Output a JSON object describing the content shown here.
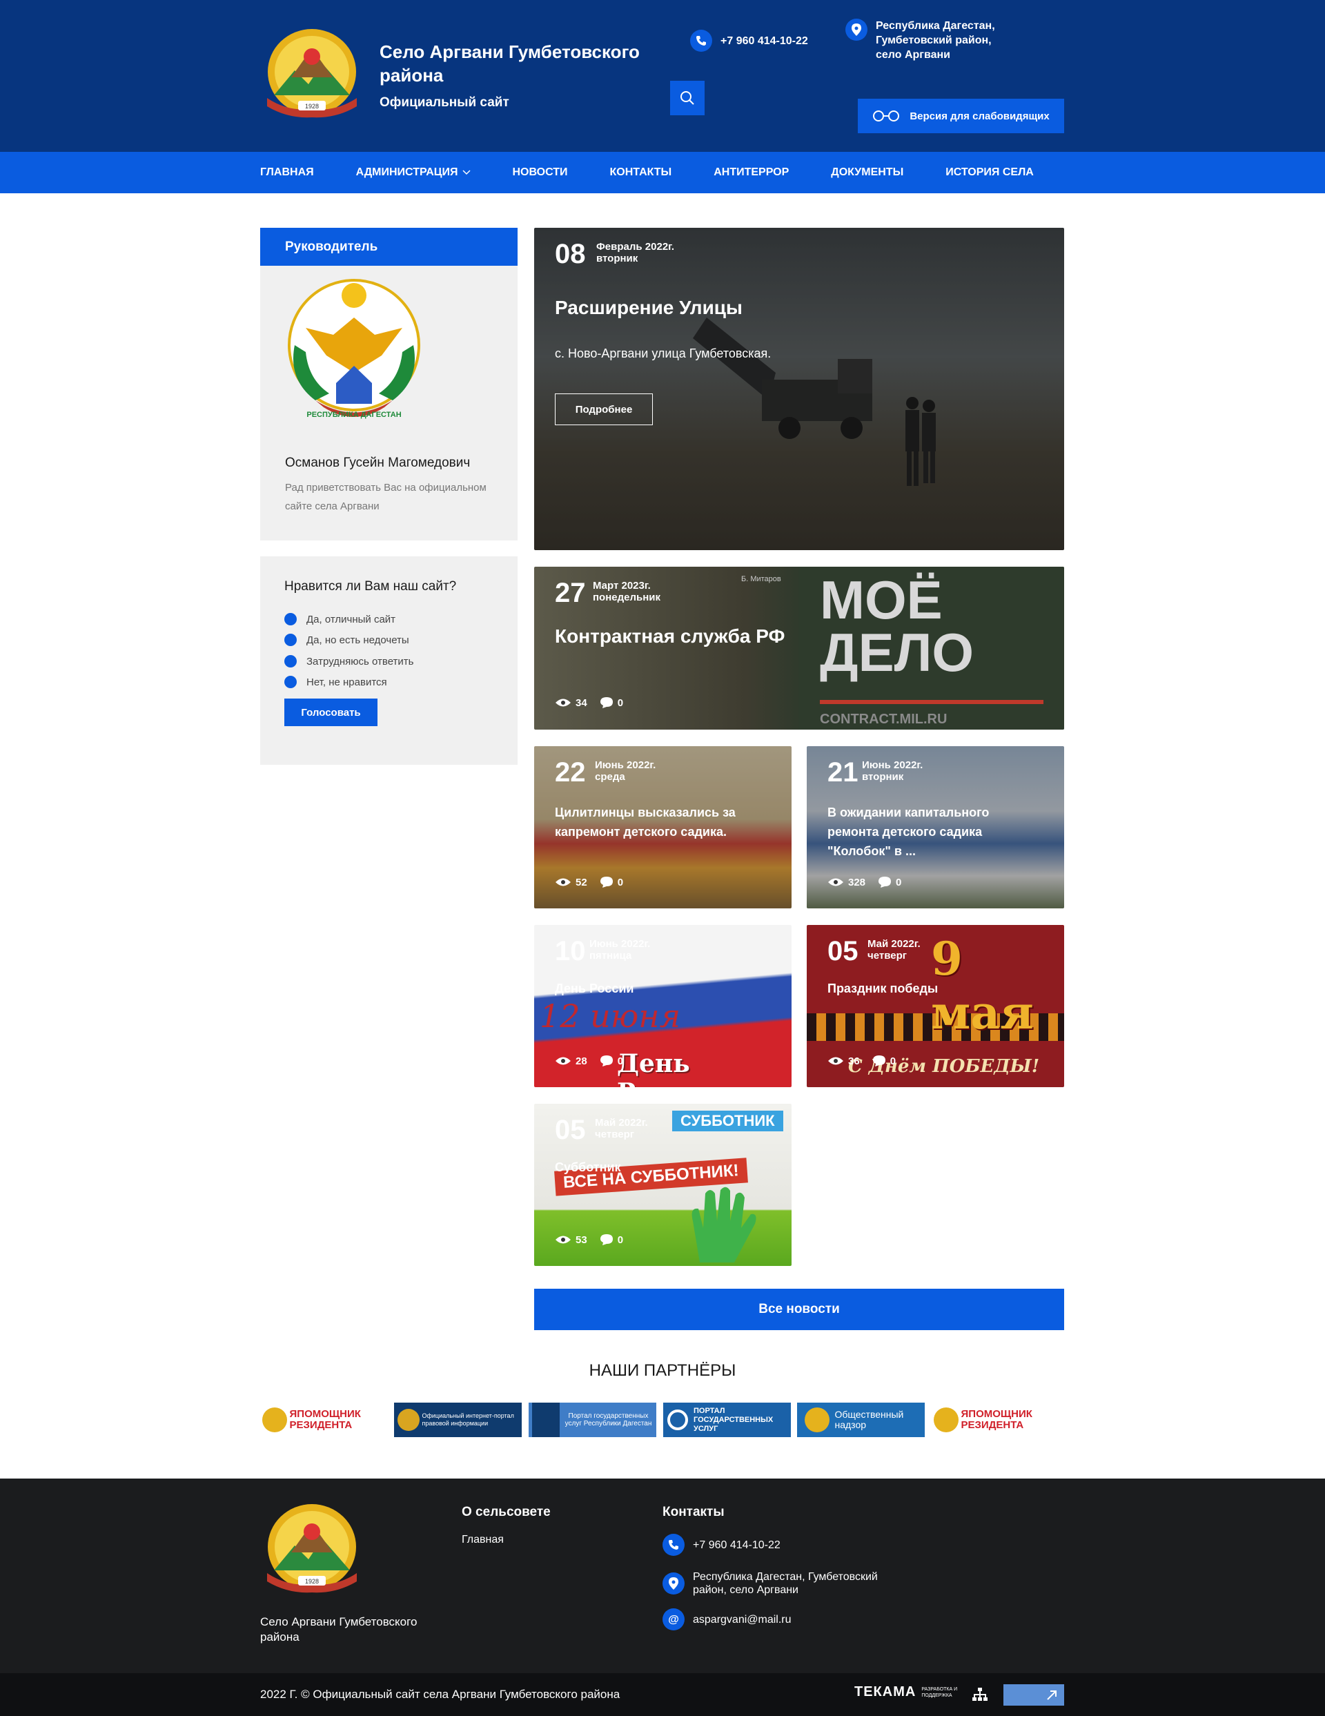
{
  "header": {
    "title": "Село Аргвани Гумбетовского района",
    "subtitle": "Официальный сайт",
    "phone": "+7 960 414-10-22",
    "address": "Республика Дагестан, Гумбетовский район, село Аргвани",
    "accessibility_label": "Версия для слабовидящих",
    "emblem_year": "1928"
  },
  "nav": {
    "items": [
      {
        "label": "Главная"
      },
      {
        "label": "Администрация"
      },
      {
        "label": "Новости"
      },
      {
        "label": "Контакты"
      },
      {
        "label": "Антитеррор"
      },
      {
        "label": "Документы"
      },
      {
        "label": "История села"
      }
    ]
  },
  "leader": {
    "heading": "Руководитель",
    "name": "Османов Гусейн Магомедович",
    "greeting": "Рад приветствовать Вас на официальном сайте села Аргвани",
    "emblem_text": "РЕСПУБЛИКА ДАГЕСТАН"
  },
  "poll": {
    "question": "Нравится ли Вам наш сайт?",
    "options": [
      "Да, отличный сайт",
      "Да, но есть недочеты",
      "Затрудняюсь ответить",
      "Нет, не нравится"
    ],
    "vote_label": "Голосовать"
  },
  "news": {
    "featured": {
      "day": "08",
      "month": "Февраль 2022г.",
      "weekday": "вторник",
      "title": "Расширение Улицы",
      "text": "с. Ново-Аргвани улица Гумбетовская.",
      "more_label": "Подробнее"
    },
    "items": [
      {
        "day": "27",
        "month": "Март 2023г.",
        "weekday": "понедельник",
        "title": "Контрактная служба РФ",
        "views": "34",
        "comments": "0",
        "overlay_big": "МОЁ ДЕЛО",
        "overlay_small": "CONTRACT.MIL.RU",
        "credit": "Б. Митаров"
      },
      {
        "day": "22",
        "month": "Июнь 2022г.",
        "weekday": "среда",
        "title": "Цилитлинцы высказались за капремонт детского садика.",
        "views": "52",
        "comments": "0"
      },
      {
        "day": "21",
        "month": "Июнь 2022г.",
        "weekday": "вторник",
        "title": "В ожидании капитального ремонта детского садика \"Колобок\" в ...",
        "views": "328",
        "comments": "0"
      },
      {
        "day": "10",
        "month": "Июнь 2022г.",
        "weekday": "пятница",
        "title": "День России",
        "views": "28",
        "comments": "0",
        "overlay_big": "12 июня",
        "overlay_small": "День России"
      },
      {
        "day": "05",
        "month": "Май 2022г.",
        "weekday": "четверг",
        "title": "Праздник победы",
        "views": "36",
        "comments": "0",
        "overlay_big": "9 мая",
        "overlay_small": "С Днём ПОБЕДЫ!"
      },
      {
        "day": "05",
        "month": "Май 2022г.",
        "weekday": "четверг",
        "title": "Субботник",
        "views": "53",
        "comments": "0",
        "overlay_big": "ВСЕ НА СУББОТНИК!",
        "overlay_small": "СУББОТНИК"
      }
    ],
    "all_label": "Все новости"
  },
  "partners": {
    "title": "Наши партнёры",
    "items": [
      {
        "name": "ЯПОМОЩНИК РЕЗИДЕНТА"
      },
      {
        "name": "Официальный интернет-портал правовой информации"
      },
      {
        "name": "Портал государственных услуг Республики Дагестан"
      },
      {
        "name": "ПОРТАЛ ГОСУДАРСТВЕННЫХ УСЛУГ"
      },
      {
        "name": "Общественный надзор"
      },
      {
        "name": "ЯПОМОЩНИК РЕЗИДЕНТА"
      }
    ]
  },
  "footer": {
    "site_name": "Село Аргвани Гумбетовского района",
    "col_about": "О сельсовете",
    "about_link": "Главная",
    "col_contacts": "Контакты",
    "phone": "+7 960 414-10-22",
    "address": "Республика Дагестан, Гумбетовский район, село Аргвани",
    "email": "aspargvani@mail.ru",
    "copyright": "2022 Г. © Официальный сайт села Аргвани Гумбетовского района",
    "dev_brand": "ТЕКАМА",
    "dev_note": "РАЗРАБОТКА И ПОДДЕРЖКА"
  },
  "colors": {
    "header_bg": "#07357f",
    "accent": "#0a5ce0",
    "footer_bg": "#1b1c1e"
  }
}
